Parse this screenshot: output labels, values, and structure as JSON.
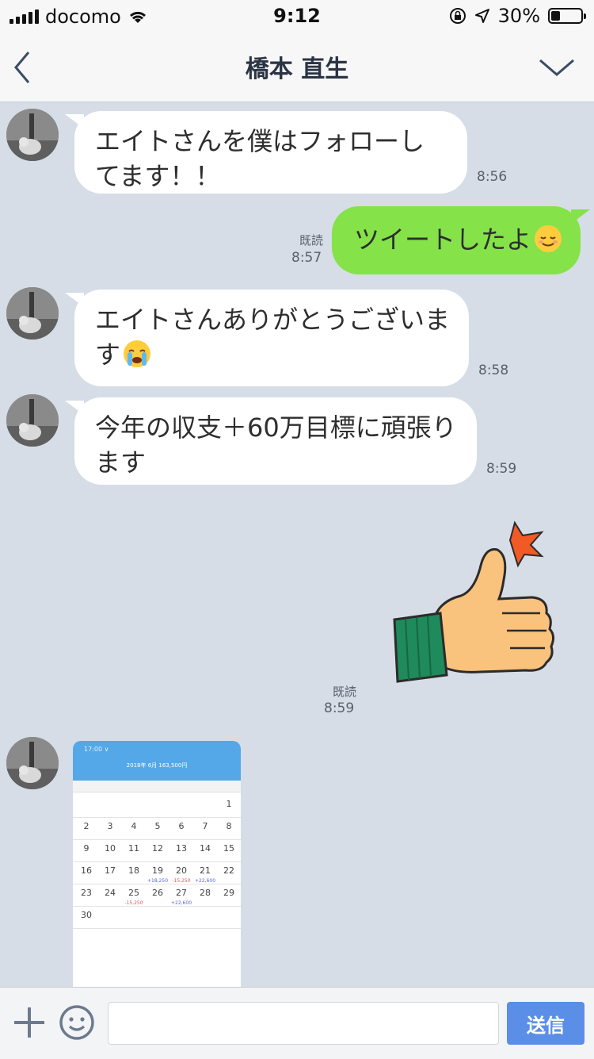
{
  "status_bar": {
    "carrier": "docomo",
    "time": "9:12",
    "battery": "30%",
    "battery_level": 0.3
  },
  "header": {
    "title": "橋本 直生",
    "back_icon": "chevron-left-icon",
    "menu_icon": "chevron-down-icon"
  },
  "messages": [
    {
      "side": "left",
      "text": "エイトさんを僕はフォローしてます！！",
      "time": "8:56"
    },
    {
      "side": "right",
      "text": "ツイートしたよ",
      "emoji": "relieved-face",
      "read": "既読",
      "time": "8:57"
    },
    {
      "side": "left",
      "text": "エイトさんありがとうございます",
      "emoji": "crying-face",
      "time": "8:58"
    },
    {
      "side": "left",
      "text": "今年の収支＋60万目標に頑張ります",
      "time": "8:59"
    },
    {
      "side": "right",
      "type": "sticker",
      "sticker": "thumbs-up-sticker",
      "read": "既読",
      "time": "8:59"
    },
    {
      "side": "left",
      "type": "image",
      "image": "calendar-screenshot"
    }
  ],
  "calendar_shot": {
    "status": "17:00 ∨",
    "title_line1": "2018年 6月",
    "title_line2": "163,500円",
    "days": [
      "1",
      "2",
      "3",
      "4",
      "5",
      "6",
      "7",
      "8",
      "9",
      "10",
      "11",
      "12",
      "13",
      "14",
      "15",
      "16",
      "17",
      "18",
      "19",
      "20",
      "21",
      "22",
      "23",
      "24",
      "25",
      "26",
      "27",
      "28",
      "29",
      "30"
    ],
    "notes": {
      "19": "+18,250",
      "20": "-15,250",
      "21": "+22,600",
      "25": "-15,250",
      "27": "+22,600"
    }
  },
  "input_bar": {
    "placeholder": "",
    "send_label": "送信"
  },
  "colors": {
    "chat_bg": "#d6dde7",
    "my_bubble": "#85e249",
    "their_bubble": "#ffffff",
    "send_button": "#5b8ee6"
  }
}
